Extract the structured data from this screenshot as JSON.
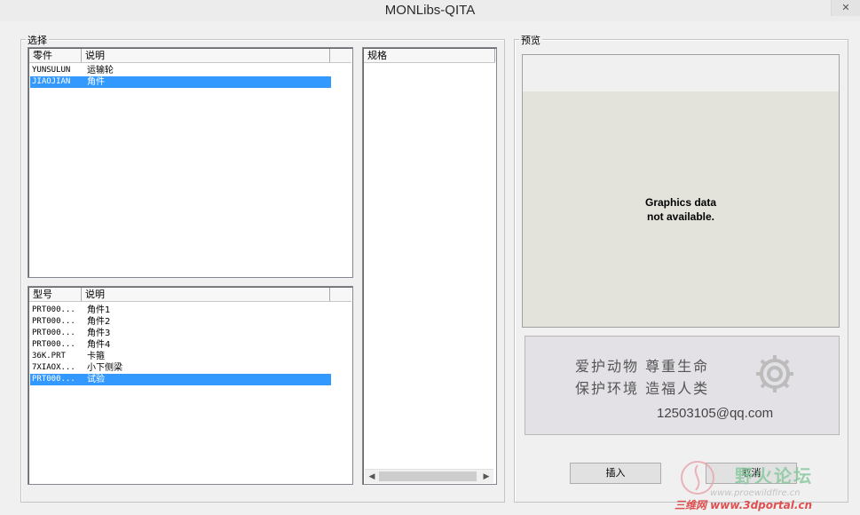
{
  "window": {
    "title": "MONLibs-QITA",
    "close_symbol": "✕"
  },
  "select_group": {
    "label": "选择"
  },
  "parts_list": {
    "columns": [
      "零件",
      "说明"
    ],
    "rows": [
      {
        "name": "YUNSULUN",
        "desc": "运输轮",
        "selected": false
      },
      {
        "name": "JIAOJIAN",
        "desc": "角件",
        "selected": true
      }
    ]
  },
  "model_list": {
    "columns": [
      "型号",
      "说明"
    ],
    "rows": [
      {
        "name": "PRT000...",
        "desc": "角件1",
        "selected": false
      },
      {
        "name": "PRT000...",
        "desc": "角件2",
        "selected": false
      },
      {
        "name": "PRT000...",
        "desc": "角件3",
        "selected": false
      },
      {
        "name": "PRT000...",
        "desc": "角件4",
        "selected": false
      },
      {
        "name": "36K.PRT",
        "desc": "卡箍",
        "selected": false
      },
      {
        "name": "7XIAOX...",
        "desc": "小下侧梁",
        "selected": false
      },
      {
        "name": "PRT000...",
        "desc": "试验",
        "selected": true
      }
    ]
  },
  "spec_list": {
    "columns": [
      "规格"
    ]
  },
  "preview_group": {
    "label": "预览",
    "no_data_line1": "Graphics data",
    "no_data_line2": "not available."
  },
  "banner": {
    "slogan1": "爱护动物  尊重生命",
    "slogan2": "保护环境  造福人类",
    "email": "12503105@qq.com"
  },
  "buttons": {
    "insert": "插入",
    "cancel": "取消"
  },
  "watermark": {
    "big": "野火论坛",
    "url": "www.proewildfire.cn",
    "red": "三维网 www.3dportal.cn"
  },
  "colors": {
    "selection": "#3399ff",
    "window_bg": "#f0f0f0"
  }
}
